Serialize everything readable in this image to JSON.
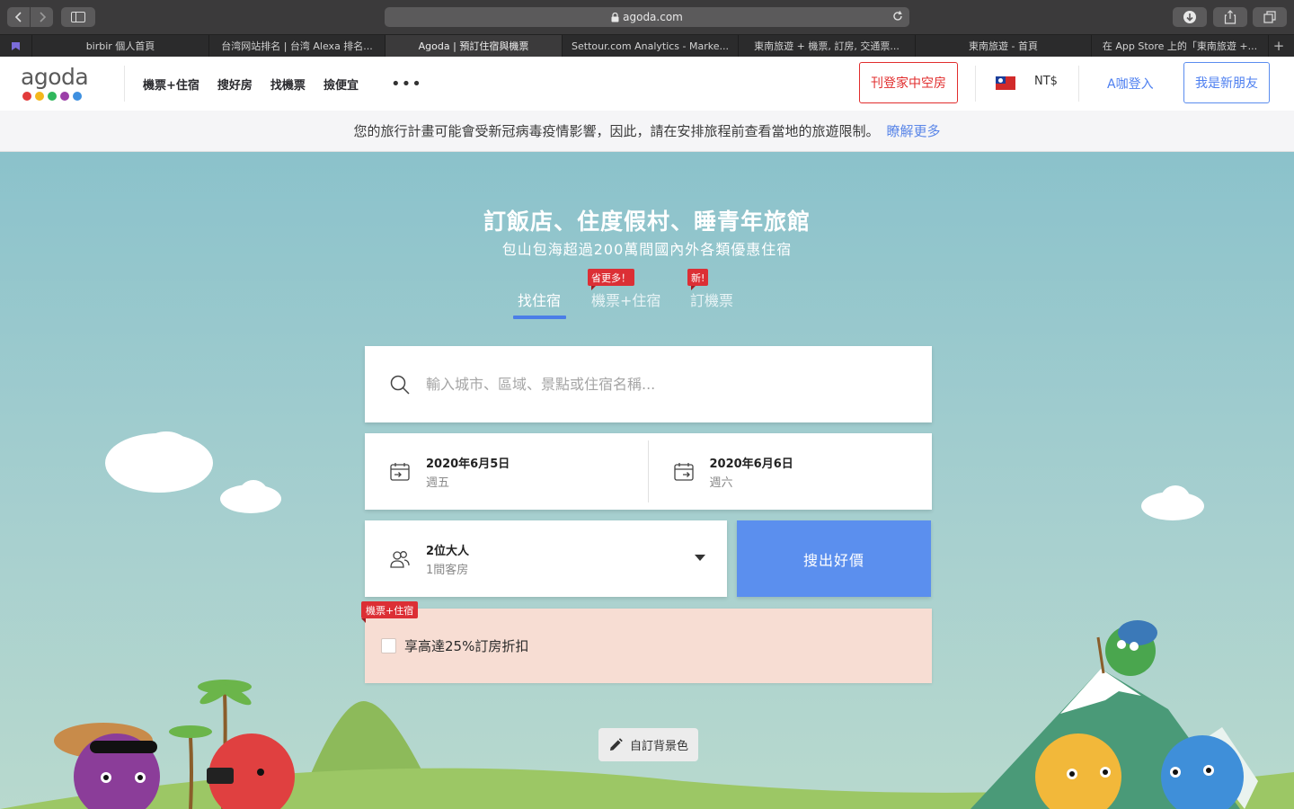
{
  "browser": {
    "url": "agoda.com",
    "tabs": [
      "birbir 個人首頁",
      "台湾网站排名 | 台湾 Alexa 排名...",
      "Agoda | 預訂住宿與機票",
      "Settour.com Analytics - Marke...",
      "東南旅遊 + 機票, 訂房, 交通票...",
      "東南旅遊 - 首頁",
      "在 App Store 上的「東南旅遊 +..."
    ],
    "active_tab": 2
  },
  "header": {
    "logo_text": "agoda",
    "logo_dot_colors": [
      "#e23b3b",
      "#f4b71c",
      "#2fb75c",
      "#9b3fa8",
      "#3e90e0"
    ],
    "nav": [
      "機票+住宿",
      "搜好房",
      "找機票",
      "撿便宜"
    ],
    "more": "•••",
    "list_property": "刊登家中空房",
    "currency": "NT$",
    "login": "A咖登入",
    "signup": "我是新朋友"
  },
  "notice": {
    "text": "您的旅行計畫可能會受新冠病毒疫情影響，因此，請在安排旅程前查看當地的旅遊限制。",
    "link": "瞭解更多"
  },
  "hero": {
    "title": "訂飯店、住度假村、睡青年旅館",
    "subtitle": "包山包海超過200萬間國內外各類優惠住宿"
  },
  "search_tabs": [
    {
      "label": "找住宿",
      "badge": ""
    },
    {
      "label": "機票+住宿",
      "badge": "省更多！"
    },
    {
      "label": "訂機票",
      "badge": "新!"
    }
  ],
  "search": {
    "placeholder": "輸入城市、區域、景點或住宿名稱..."
  },
  "dates": {
    "checkin": {
      "date": "2020年6月5日",
      "weekday": "週五"
    },
    "checkout": {
      "date": "2020年6月6日",
      "weekday": "週六"
    }
  },
  "guests": {
    "adults": "2位大人",
    "rooms": "1間客房"
  },
  "search_button": "搜出好價",
  "promo": {
    "badge": "機票+住宿",
    "label": "享高達25%訂房折扣"
  },
  "customize_bg": "自訂背景色",
  "colors": {
    "brand_blue": "#5b8fee",
    "brand_red": "#dc2f35",
    "hero_bg": "#8bc2cb",
    "promo_bg": "#f7ddd3"
  }
}
